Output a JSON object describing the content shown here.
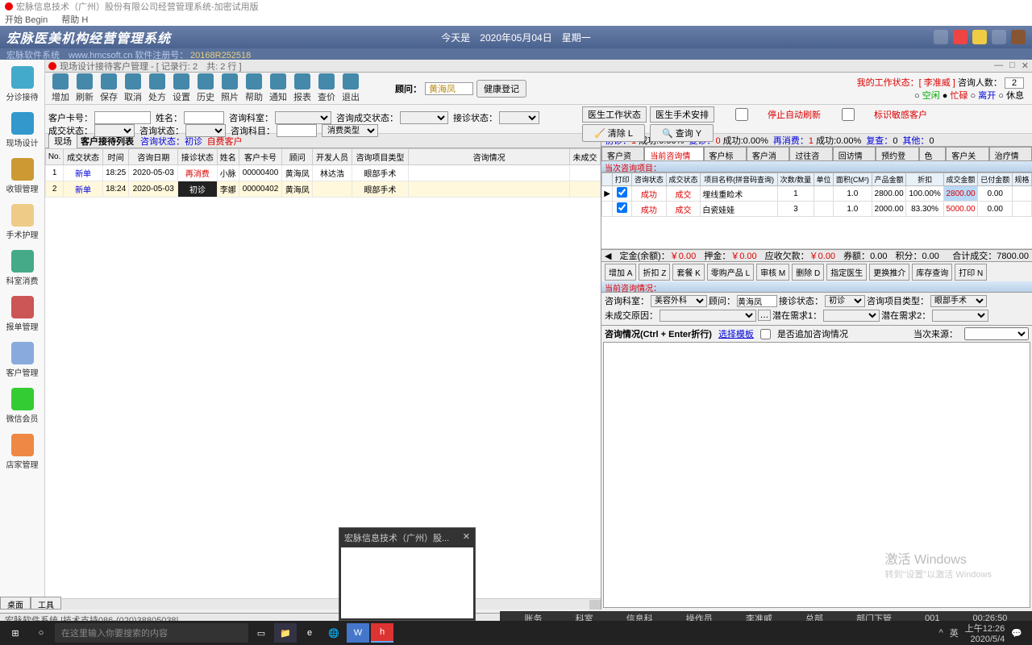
{
  "window": {
    "title": "宏脉信息技术（广州）股份有限公司经营管理系统-加密试用版",
    "menu": {
      "begin": "开始 Begin",
      "help": "帮助 H"
    }
  },
  "banner": {
    "title": "宏脉医美机构经营管理系统",
    "date": "今天是　2020年05月04日　星期一",
    "sub_left": "宏脉软件系统　www.hmcsoft.cn",
    "sub_right": "软件注册号：",
    "reg": "20168R252518"
  },
  "sidebar": [
    {
      "id": "triage",
      "label": "分诊接待"
    },
    {
      "id": "onsite",
      "label": "现场设计"
    },
    {
      "id": "cashier",
      "label": "收银管理"
    },
    {
      "id": "surgery",
      "label": "手术护理"
    },
    {
      "id": "dept",
      "label": "科室消费"
    },
    {
      "id": "report",
      "label": "报单管理"
    },
    {
      "id": "customer",
      "label": "客户管理"
    },
    {
      "id": "wechat",
      "label": "微信会员"
    },
    {
      "id": "store",
      "label": "店家管理"
    }
  ],
  "tab": {
    "title": "现场设计接待客户管理 - [ 记录行: 2　共: 2 行 ]"
  },
  "toolbar": [
    {
      "id": "add",
      "label": "增加"
    },
    {
      "id": "refresh",
      "label": "刷新"
    },
    {
      "id": "save",
      "label": "保存"
    },
    {
      "id": "cancel",
      "label": "取消"
    },
    {
      "id": "rx",
      "label": "处方"
    },
    {
      "id": "settings",
      "label": "设置"
    },
    {
      "id": "history",
      "label": "历史"
    },
    {
      "id": "photo",
      "label": "照片"
    },
    {
      "id": "help",
      "label": "帮助"
    },
    {
      "id": "notify",
      "label": "通知"
    },
    {
      "id": "report",
      "label": "报表"
    },
    {
      "id": "price",
      "label": "查价"
    },
    {
      "id": "exit",
      "label": "退出"
    }
  ],
  "consultant": {
    "label": "顾问：",
    "value": "黄海凤",
    "health_btn": "健康登记"
  },
  "my_status": {
    "line": "我的工作状态：[ 李准威 ]",
    "opts": {
      "free": "空闲",
      "busy": "忙碌",
      "away": "离开",
      "rest": "休息"
    },
    "visitors_lbl": "咨询人数：",
    "visitors": "2"
  },
  "filters": {
    "card": "客户卡号：",
    "name": "姓名：",
    "dept_lbl": "咨询科室：",
    "deal": "咨询成交状态：",
    "recv": "接诊状态：",
    "deal2": "成交状态：",
    "cstat": "咨询状态：",
    "csub": "咨询科目：",
    "ctype": "消费类型",
    "doc_status": "医生工作状态",
    "doc_sched": "医生手术安排",
    "chk_auto": "停止自动刷新",
    "chk_sens": "标识敏感客户",
    "clear": "清除 L",
    "query": "查询 Y"
  },
  "list": {
    "tab": "现场",
    "title": "客户接待列表",
    "st1": "咨询状态：初诊",
    "st2": "自费客户",
    "cols": [
      "No.",
      "成交状态",
      "时间",
      "咨询日期",
      "接诊状态",
      "姓名",
      "客户卡号",
      "顾问",
      "开发人员",
      "咨询项目类型",
      "咨询情况",
      "未成交"
    ],
    "rows": [
      {
        "no": "1",
        "deal": "新单",
        "time": "18:25",
        "date": "2020-05-03",
        "recv": "再消费",
        "name": "小脉",
        "card": "00000400",
        "adv": "黄海凤",
        "dev": "林达浩",
        "ptype": "眼部手术"
      },
      {
        "no": "2",
        "deal": "新单",
        "time": "18:24",
        "date": "2020-05-03",
        "recv": "初诊",
        "name": "李娜",
        "card": "00000402",
        "adv": "黄海凤",
        "dev": "",
        "ptype": "眼部手术"
      }
    ]
  },
  "stats": {
    "first": "初诊：",
    "first_n": "1",
    "first_r": "成功:0.00%",
    "re": "复诊：",
    "re_n": "0",
    "re_r": "成功:0.00%",
    "again": "再消费：",
    "again_n": "1",
    "again_r": "成功:0.00%",
    "chk": "复查：",
    "chk_n": "0",
    "other": "其他：",
    "other_n": "0"
  },
  "rtabs": [
    "客户资料",
    "当前咨询情况",
    "客户标签",
    "客户消费",
    "过往咨询",
    "回访情况",
    "预约登记",
    "色卡",
    "客户关系",
    "治疗情况"
  ],
  "rtab_active": 1,
  "items": {
    "hdr": "当次咨询项目：",
    "cols": [
      "打印",
      "咨询状态",
      "成交状态",
      "项目名称(拼音码查询)",
      "次数/数量",
      "单位",
      "面积(CM²)",
      "产品金额",
      "折扣",
      "成交金额",
      "已付金额",
      "规格"
    ],
    "rows": [
      {
        "p": true,
        "cs": "成功",
        "ds": "成交",
        "name": "埋线重睑术",
        "qty": "1",
        "unit": "",
        "area": "1.0",
        "amt": "2800.00",
        "disc": "100.00%",
        "deal": "2800.00",
        "paid": "0.00"
      },
      {
        "p": true,
        "cs": "成功",
        "ds": "成交",
        "name": "白瓷娃娃",
        "qty": "3",
        "unit": "",
        "area": "1.0",
        "amt": "2000.00",
        "disc": "83.30%",
        "deal": "5000.00",
        "paid": "0.00"
      }
    ]
  },
  "summary": {
    "deposit": "定金(余额)：",
    "deposit_v": "￥0.00",
    "pledge": "押金：",
    "pledge_v": "￥0.00",
    "owe": "应收欠款：",
    "owe_v": "￥0.00",
    "coupon": "券额：",
    "coupon_v": "0.00",
    "points": "积分：",
    "points_v": "0.00",
    "total": "合计成交：",
    "total_v": "7800.00"
  },
  "btns": [
    "增加 A",
    "折扣 Z",
    "套餐 K",
    "零购产品 L",
    "审核 M",
    "删除 D",
    "指定医生",
    "更换推介",
    "库存查询",
    "打印 N"
  ],
  "detail": {
    "hdr": "当前咨询情况：",
    "dept": "咨询科室：",
    "dept_v": "美容外科",
    "adv": "顾问：",
    "adv_v": "黄海凤",
    "recv": "接诊状态：",
    "recv_v": "初诊",
    "ptype": "咨询项目类型：",
    "ptype_v": "眼部手术",
    "reason": "未成交原因：",
    "need1": "潜在需求1：",
    "need2": "潜在需求2：",
    "consult": "咨询情况(Ctrl + Enter折行)",
    "tpl": "选择模板",
    "append": "是否追加咨询情况",
    "src": "当次来源："
  },
  "footer_tabs": [
    "桌面",
    "工具"
  ],
  "statusbar": "宏脉软件系统 |技术支持086-(020)38805038|",
  "depts": [
    "账务",
    "科室",
    "信息科",
    "操作员",
    "李准威",
    "总部",
    "部门下管",
    "001",
    "00:26:50"
  ],
  "watermark": {
    "l1": "激活 Windows",
    "l2": "转到\"设置\"以激活 Windows"
  },
  "taskbar": {
    "search": "在这里输入你要搜索的内容",
    "time": "上午12:26",
    "date": "2020/5/4"
  },
  "thumb": {
    "title": "宏脉信息技术（广州）股..."
  }
}
